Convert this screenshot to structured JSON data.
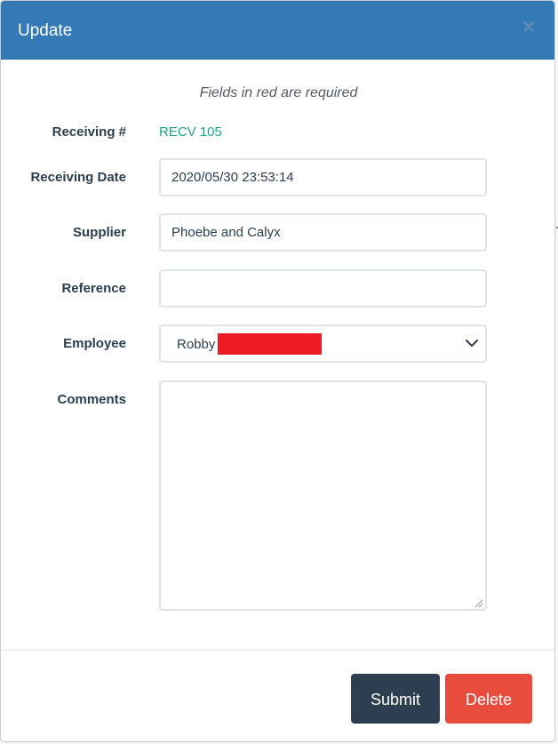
{
  "modal": {
    "title": "Update",
    "close_label": "×"
  },
  "form": {
    "required_note": "Fields in red are required",
    "receiving_number": {
      "label": "Receiving #",
      "value": "RECV 105"
    },
    "receiving_date": {
      "label": "Receiving Date",
      "value": "2020/05/30 23:53:14"
    },
    "supplier": {
      "label": "Supplier",
      "value": "Phoebe and Calyx"
    },
    "reference": {
      "label": "Reference",
      "value": ""
    },
    "employee": {
      "label": "Employee",
      "selected": "Robby"
    },
    "comments": {
      "label": "Comments",
      "value": ""
    }
  },
  "footer": {
    "submit_label": "Submit",
    "delete_label": "Delete"
  },
  "colors": {
    "header": "#337ab7",
    "link_value": "#18a689",
    "submit": "#2c3e50",
    "delete": "#e74c3c",
    "redaction": "#ed1c24"
  },
  "icons": {
    "close": "close-icon",
    "select_arrow": "chevron-down-icon",
    "resize": "resize-grip-icon"
  }
}
